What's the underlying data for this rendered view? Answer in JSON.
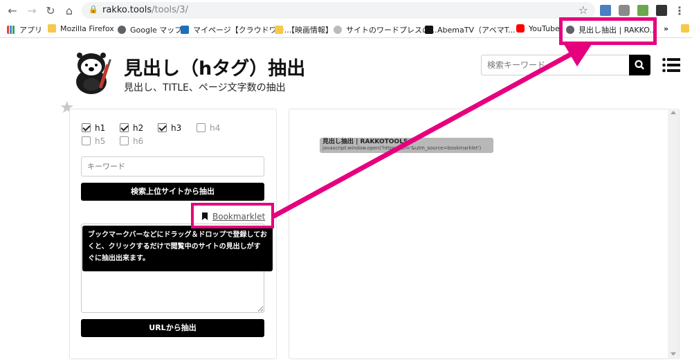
{
  "browser": {
    "url_host": "rakko.tools",
    "url_path": "/tools/3/",
    "bookmarks": [
      {
        "label": "アプリ",
        "icon": "apps-grid-icon",
        "color": "#4285f4"
      },
      {
        "label": "Mozilla Firefox",
        "icon": "folder-icon",
        "color": "#f6c94b"
      },
      {
        "label": "Google マップ",
        "icon": "globe-icon",
        "color": "#5f6368"
      },
      {
        "label": "マイページ【クラウドワー...",
        "icon": "crowdworks-icon",
        "color": "#1f6fbf"
      },
      {
        "label": "【映画情報】",
        "icon": "folder-icon",
        "color": "#f6c94b"
      },
      {
        "label": "サイトのワードプレスの...",
        "icon": "search-icon",
        "color": "#777777"
      },
      {
        "label": "AbemaTV（アベマT...",
        "icon": "abema-icon",
        "color": "#111111"
      },
      {
        "label": "YouTube",
        "icon": "youtube-icon",
        "color": "#ff0000"
      },
      {
        "label": "見出し抽出 | RAKKO...",
        "icon": "globe-icon",
        "color": "#5f6368"
      }
    ],
    "overflow_label": "»"
  },
  "header": {
    "title": "見出し（hタグ）抽出",
    "subtitle": "見出し、TITLE、ページ文字数の抽出",
    "search_placeholder": "検索キーワード"
  },
  "form": {
    "checkboxes": [
      {
        "label": "h1",
        "checked": true
      },
      {
        "label": "h2",
        "checked": true
      },
      {
        "label": "h3",
        "checked": true
      },
      {
        "label": "h4",
        "checked": false
      },
      {
        "label": "h5",
        "checked": false
      },
      {
        "label": "h6",
        "checked": false
      }
    ],
    "keyword_placeholder": "キーワード",
    "extract_top_label": "検索上位サイトから抽出",
    "bookmarklet_label": "Bookmarklet",
    "tooltip": "ブックマークバーなどにドラッグ＆ドロップで登録しておくと、クリックするだけで閲覧中のサイトの見出しがすぐに抽出出来ます。",
    "extract_url_label": "URLから抽出"
  },
  "drag_ghost": {
    "title": "見出し抽出 | RAKKOTOOLS",
    "code": "javascript:window.open('https:...ef='&utm_source=bookmarklet')"
  },
  "colors": {
    "highlight": "#e6007e",
    "button": "#000000"
  }
}
